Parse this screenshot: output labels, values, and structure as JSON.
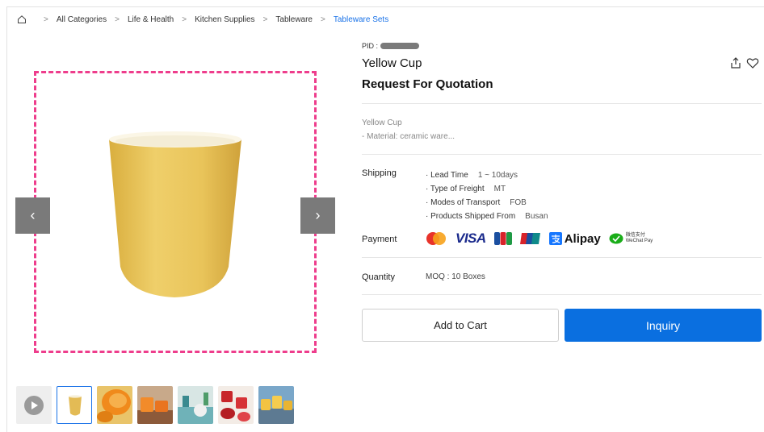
{
  "breadcrumb": {
    "items": [
      "All Categories",
      "Life & Health",
      "Kitchen Supplies",
      "Tableware"
    ],
    "active": "Tableware Sets"
  },
  "product": {
    "pid_label": "PID :",
    "title": "Yellow Cup",
    "subtitle": "Request For Quotation",
    "desc_line1": "Yellow Cup",
    "desc_line2": "- Material: ceramic ware..."
  },
  "shipping": {
    "label": "Shipping",
    "rows": [
      {
        "key": "· Lead Time",
        "value": "1 ~ 10days"
      },
      {
        "key": "· Type of Freight",
        "value": "MT"
      },
      {
        "key": "· Modes of Transport",
        "value": "FOB"
      },
      {
        "key": "· Products Shipped From",
        "value": "Busan"
      }
    ]
  },
  "payment": {
    "label": "Payment",
    "methods": [
      "mastercard-icon",
      "VISA",
      "jcb-icon",
      "unionpay-icon",
      "Alipay",
      "wechat-pay-icon"
    ],
    "visa_text": "VISA",
    "alipay_text": "Alipay",
    "wechat_cn": "微信支付",
    "wechat_en": "WeChat Pay"
  },
  "quantity": {
    "label": "Quantity",
    "moq": "MOQ : 10 Boxes"
  },
  "actions": {
    "add_to_cart": "Add to Cart",
    "inquiry": "Inquiry"
  },
  "colors": {
    "accent": "#0a6fe0",
    "highlight_border": "#ee3d8c",
    "cup_yellow": "#e8c35a"
  }
}
